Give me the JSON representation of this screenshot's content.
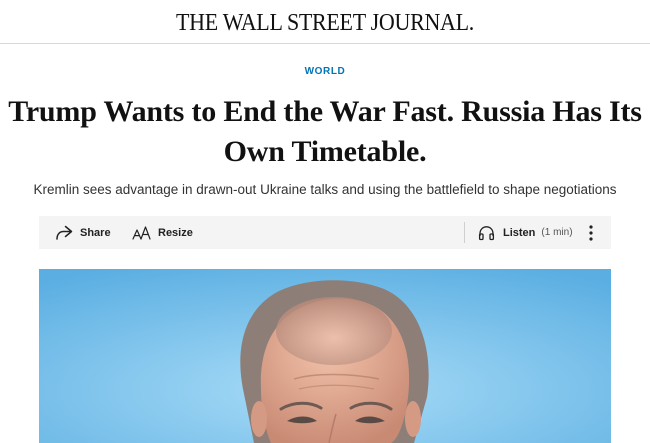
{
  "masthead": {
    "title": "THE WALL STREET JOURNAL."
  },
  "article": {
    "section": "WORLD",
    "headline_line1": "Trump Wants to End the War Fast. Russia Has Its",
    "headline_line2": "Own Timetable.",
    "dek": "Kremlin sees advantage in drawn-out Ukraine talks and using the battlefield to shape negotiations"
  },
  "toolbar": {
    "share_label": "Share",
    "share_icon": "share-arrow-icon",
    "resize_label": "Resize",
    "resize_icon": "text-resize-icon",
    "listen_label": "Listen",
    "listen_icon": "headphones-icon",
    "listen_duration": "(1 min)",
    "more_icon": "vertical-ellipsis-icon"
  },
  "colors": {
    "section_label": "#0274b6",
    "toolbar_bg": "#f4f4f4",
    "hero_sky": "#6fb9e6"
  }
}
